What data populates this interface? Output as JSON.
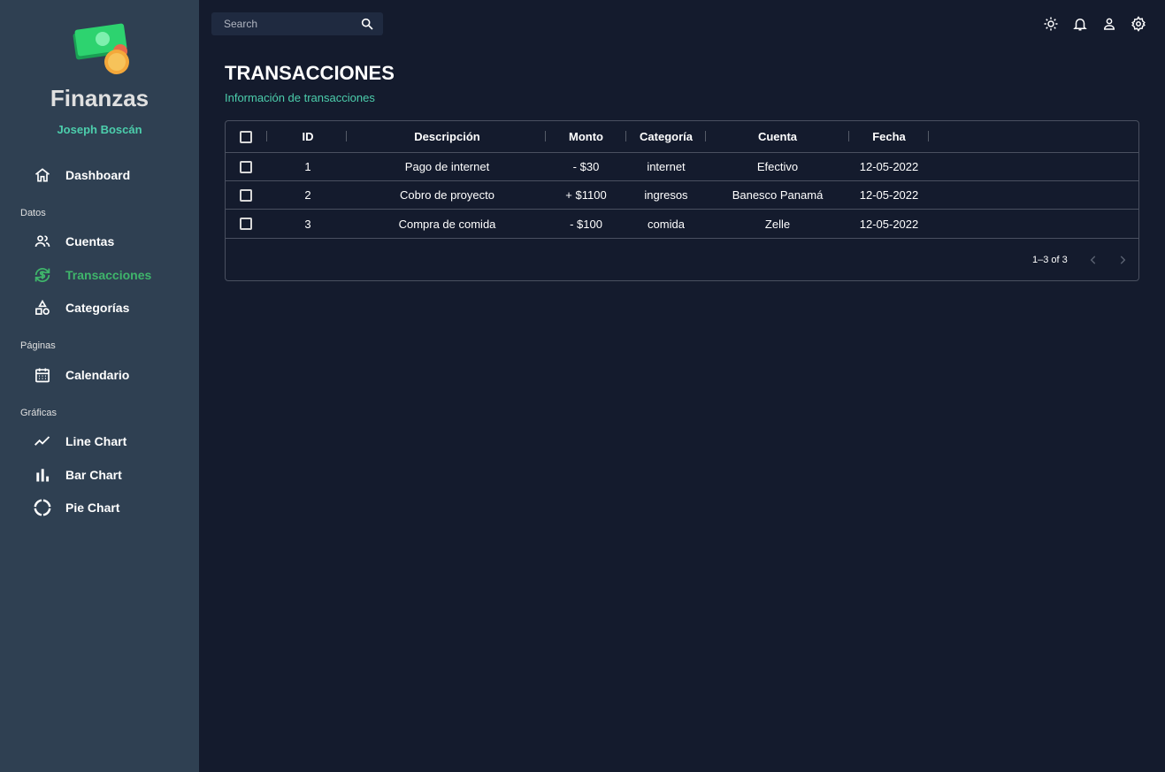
{
  "sidebar": {
    "brand": "Finanzas",
    "user": "Joseph Boscán",
    "items": [
      {
        "label": "Dashboard",
        "icon": "home-icon"
      },
      {
        "section": "Datos"
      },
      {
        "label": "Cuentas",
        "icon": "people-icon"
      },
      {
        "label": "Transacciones",
        "icon": "currency-exchange-icon",
        "active": true
      },
      {
        "label": "Categorías",
        "icon": "category-icon"
      },
      {
        "section": "Páginas"
      },
      {
        "label": "Calendario",
        "icon": "calendar-icon"
      },
      {
        "section": "Gráficas"
      },
      {
        "label": "Line Chart",
        "icon": "line-chart-icon"
      },
      {
        "label": "Bar Chart",
        "icon": "bar-chart-icon"
      },
      {
        "label": "Pie Chart",
        "icon": "pie-chart-icon"
      }
    ]
  },
  "topbar": {
    "search_placeholder": "Search",
    "icons": [
      "light-mode-icon",
      "notifications-icon",
      "person-icon",
      "settings-icon"
    ]
  },
  "header": {
    "title": "TRANSACCIONES",
    "subtitle": "Información de transacciones"
  },
  "table": {
    "columns": [
      "ID",
      "Descripción",
      "Monto",
      "Categoría",
      "Cuenta",
      "Fecha"
    ],
    "rows": [
      [
        "1",
        "Pago de internet",
        "- $30",
        "internet",
        "Efectivo",
        "12-05-2022"
      ],
      [
        "2",
        "Cobro de proyecto",
        "+ $1100",
        "ingresos",
        "Banesco Panamá",
        "12-05-2022"
      ],
      [
        "3",
        "Compra de comida",
        "- $100",
        "comida",
        "Zelle",
        "12-05-2022"
      ]
    ],
    "pagination": "1–3 of 3"
  },
  "colors": {
    "background": "#141b2d",
    "sidebar": "#2f4052",
    "accent": "#4cceac",
    "active": "#3fb56b"
  }
}
